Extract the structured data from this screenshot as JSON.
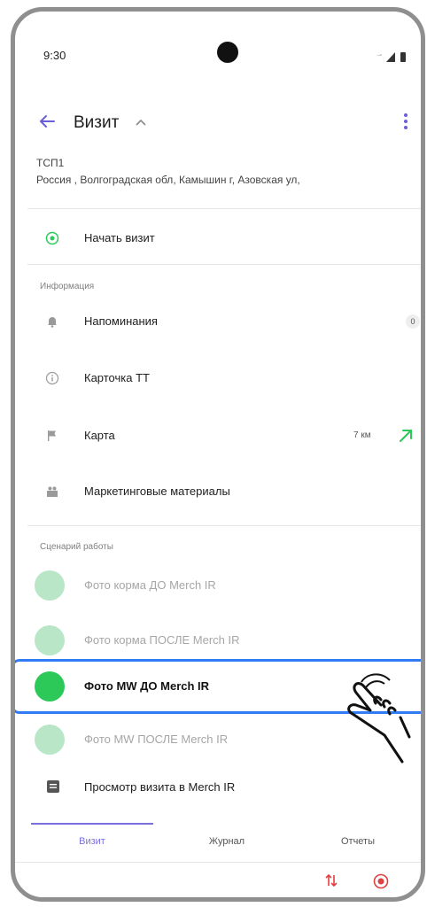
{
  "status_bar": {
    "time": "9:30"
  },
  "app_bar": {
    "title": "Визит"
  },
  "outlet": {
    "name": "ТСП1",
    "address": "Россия , Волгоградская обл, Камышин г, Азовская ул,"
  },
  "start_visit": {
    "label": "Начать визит"
  },
  "info": {
    "section_title": "Информация",
    "items": [
      {
        "label": "Напоминания",
        "icon": "bell-icon",
        "badge": "0"
      },
      {
        "label": "Карточка ТТ",
        "icon": "info-icon"
      },
      {
        "label": "Карта",
        "icon": "flag-icon",
        "distance": "7 км"
      },
      {
        "label": "Маркетинговые материалы",
        "icon": "materials-icon"
      }
    ]
  },
  "scenario": {
    "section_title": "Сценарий работы",
    "steps": [
      {
        "label": "Фото корма  ДО Merch IR",
        "state": "done"
      },
      {
        "label": "Фото корма ПОСЛЕ Merch IR",
        "state": "done"
      },
      {
        "label": "Фото MW  ДО Merch IR",
        "state": "active",
        "mark": "!"
      },
      {
        "label": "Фото MW  ПОСЛЕ Merch IR",
        "state": "done"
      }
    ],
    "view_visit_label": "Просмотр визита в Merch IR"
  },
  "tabs": [
    {
      "label": "Визит",
      "active": true
    },
    {
      "label": "Журнал",
      "active": false
    },
    {
      "label": "Отчеты",
      "active": false
    }
  ],
  "colors": {
    "accent": "#7b6fe0",
    "step_done": "#b8e6c6",
    "step_active": "#2cc858",
    "highlight": "#2f7cf6",
    "alert": "#e04040",
    "map_arrow": "#2cc858"
  }
}
